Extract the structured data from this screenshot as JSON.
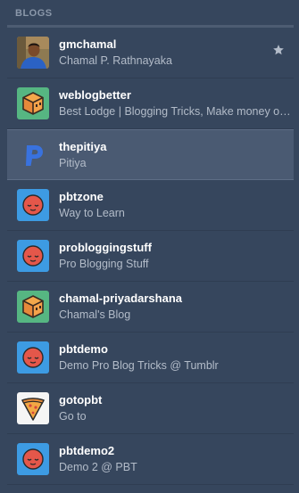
{
  "section_title": "BLOGS",
  "blogs": [
    {
      "name": "gmchamal",
      "description": "Chamal P. Rathnayaka",
      "avatar": "photo-avatar",
      "starred": true
    },
    {
      "name": "weblogbetter",
      "description": "Best Lodge | Blogging Tricks, Make money online",
      "avatar": "cube-avatar-green"
    },
    {
      "name": "thepitiya",
      "description": "Pitiya",
      "avatar": "p-letter-avatar",
      "selected": true
    },
    {
      "name": "pbtzone",
      "description": "Way to Learn",
      "avatar": "face-avatar-blue"
    },
    {
      "name": "problogging­stuff",
      "description": "Pro Blogging Stuff",
      "avatar": "face-avatar-blue"
    },
    {
      "name": "chamal-priyadarshana",
      "description": "Chamal's Blog",
      "avatar": "cube-avatar-green"
    },
    {
      "name": "pbtdemo",
      "description": "Demo Pro Blog Tricks @ Tumblr",
      "avatar": "face-avatar-blue"
    },
    {
      "name": "gotopbt",
      "description": "Go to",
      "avatar": "pizza-avatar-white"
    },
    {
      "name": "pbtdemo2",
      "description": "Demo 2 @ PBT",
      "avatar": "face-avatar-blue"
    }
  ],
  "colors": {
    "background": "#36465d",
    "selected_row": "#4a5a72",
    "avatar_blue": "#3d9be3",
    "avatar_green": "#56b682",
    "avatar_face": "#e4574a",
    "p_logo": "#3972de"
  }
}
